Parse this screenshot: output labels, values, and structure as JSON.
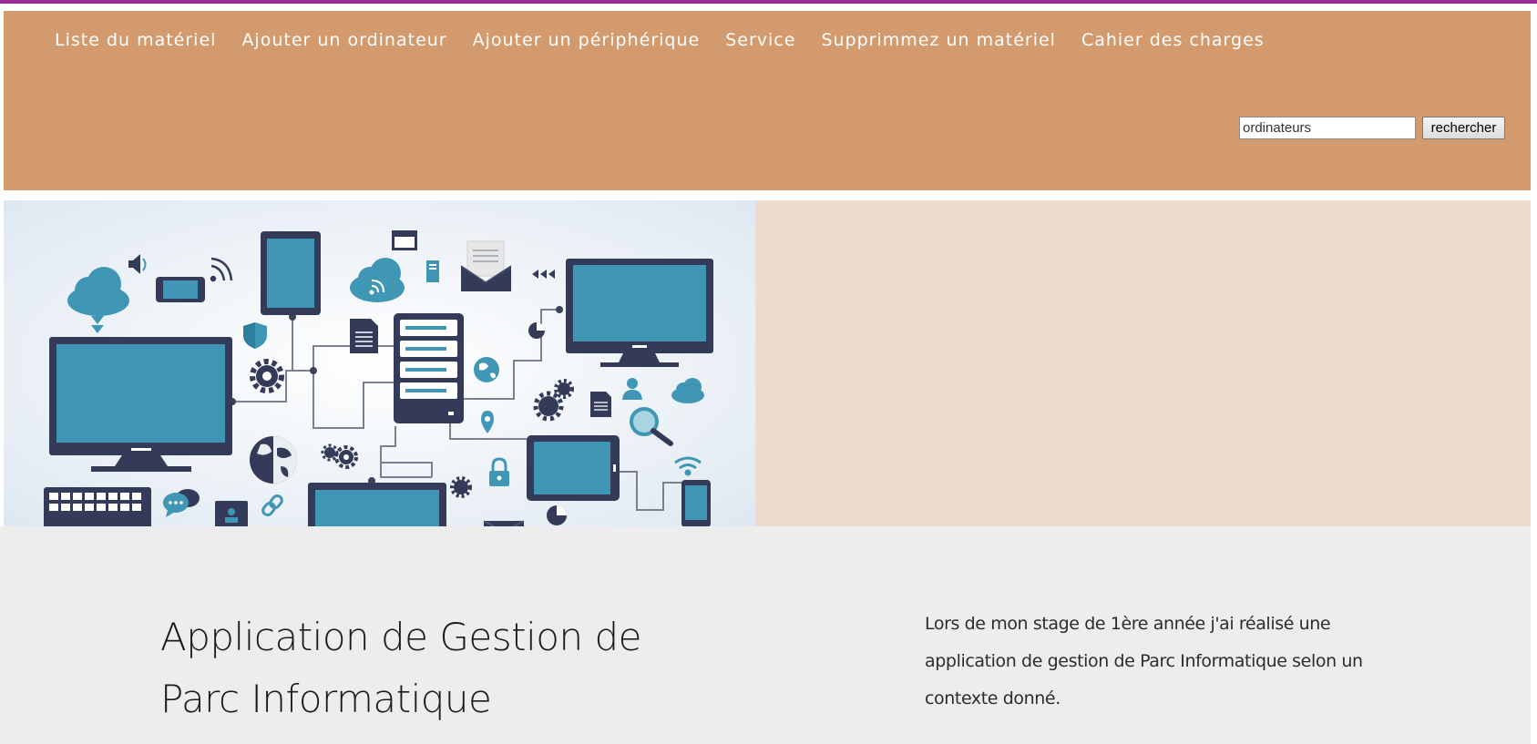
{
  "nav": {
    "items": [
      {
        "label": "Liste du matériel"
      },
      {
        "label": "Ajouter un ordinateur"
      },
      {
        "label": "Ajouter un périphérique"
      },
      {
        "label": "Service"
      },
      {
        "label": "Supprimmez un matériel"
      },
      {
        "label": "Cahier des charges"
      }
    ]
  },
  "search": {
    "value": "ordinateurs",
    "button_label": "rechercher"
  },
  "hero": {
    "illustration_icons": [
      "cloud-icon",
      "speaker-icon",
      "phone-icon",
      "wifi-icon",
      "tablet-icon",
      "browser-icon",
      "cloud-rss-icon",
      "tower-icon",
      "email-icon",
      "arrows-icon",
      "monitor-icon",
      "shield-icon",
      "document-icon",
      "server-icon",
      "pie-chart-icon",
      "gear-icon",
      "globe-icon",
      "location-pin-icon",
      "user-icon",
      "magnifier-icon",
      "lock-icon",
      "keyboard-icon",
      "chat-icon",
      "link-icon",
      "laptop-icon"
    ]
  },
  "content": {
    "title_line1": "Application de Gestion de",
    "title_line2": "Parc Informatique",
    "paragraph": "Lors de mon stage de 1ère année j'ai réalisé une application de gestion de Parc Informatique selon un contexte donné."
  },
  "colors": {
    "top_line": "#9b2a92",
    "header_bg": "#d39a6e",
    "hero_right_bg": "#ecdccf",
    "section_bg": "#ededed",
    "icon_blue": "#3f97b5",
    "icon_dark": "#343b58"
  }
}
